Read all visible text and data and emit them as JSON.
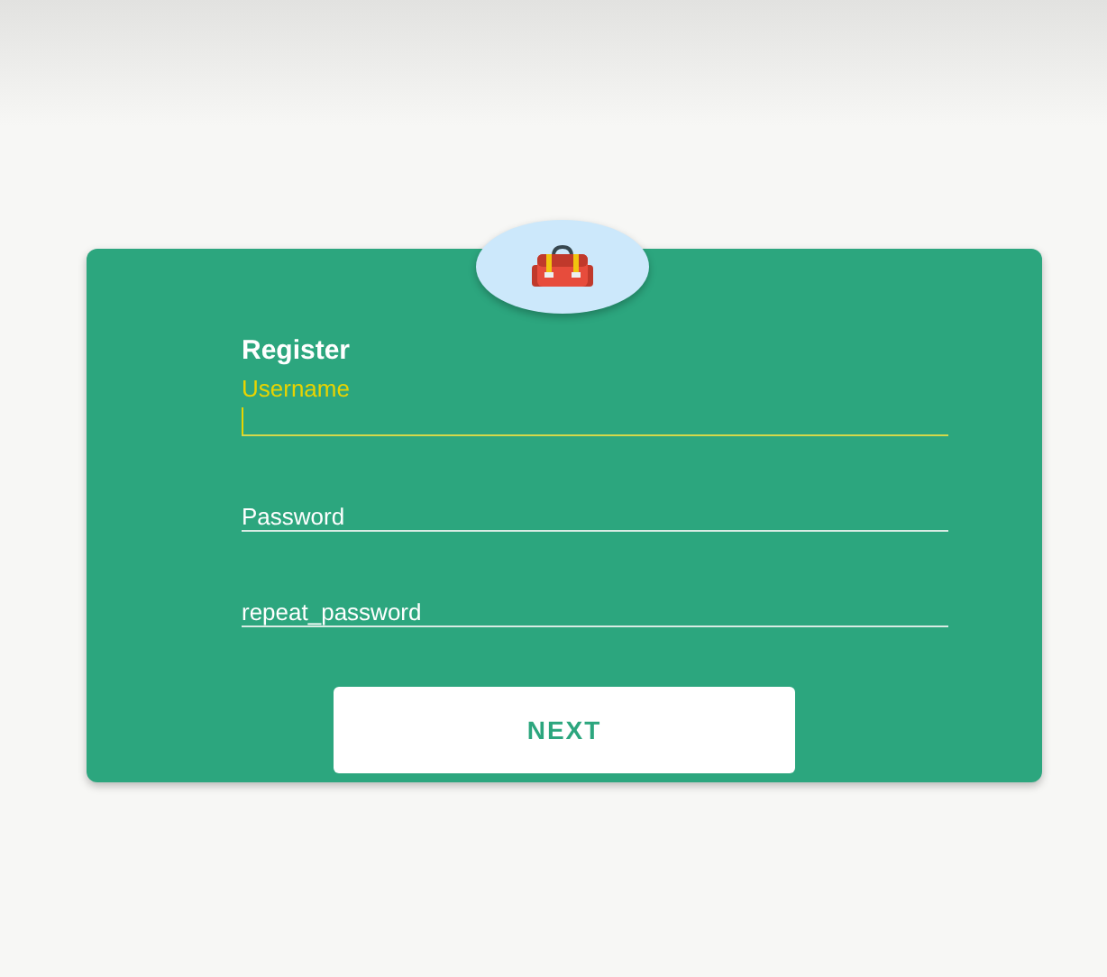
{
  "card": {
    "title": "Register",
    "fields": [
      {
        "label": "Username",
        "focused": true
      },
      {
        "label": "Password",
        "focused": false
      },
      {
        "label": "repeat_password",
        "focused": false
      }
    ],
    "button": "NEXT"
  }
}
